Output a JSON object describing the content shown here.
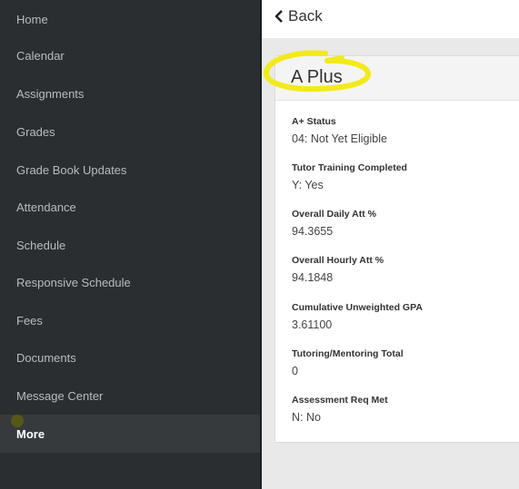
{
  "sidebar": {
    "items": [
      {
        "label": "Home"
      },
      {
        "label": "Calendar"
      },
      {
        "label": "Assignments"
      },
      {
        "label": "Grades"
      },
      {
        "label": "Grade Book Updates"
      },
      {
        "label": "Attendance"
      },
      {
        "label": "Schedule"
      },
      {
        "label": "Responsive Schedule"
      },
      {
        "label": "Fees"
      },
      {
        "label": "Documents"
      },
      {
        "label": "Message Center"
      },
      {
        "label": "More",
        "active": true
      }
    ]
  },
  "header": {
    "back_label": "Back"
  },
  "card": {
    "title": "A Plus",
    "fields": [
      {
        "label": "A+ Status",
        "value": "04: Not Yet Eligible"
      },
      {
        "label": "Tutor Training Completed",
        "value": "Y: Yes"
      },
      {
        "label": "Overall Daily Att %",
        "value": "94.3655"
      },
      {
        "label": "Overall Hourly Att %",
        "value": "94.1848"
      },
      {
        "label": "Cumulative Unweighted GPA",
        "value": "3.61100"
      },
      {
        "label": "Tutoring/Mentoring Total",
        "value": "0"
      },
      {
        "label": "Assessment Req Met",
        "value": "N: No"
      }
    ]
  },
  "colors": {
    "sidebar_bg": "#2b2e30",
    "highlight": "#f2ea1a"
  }
}
